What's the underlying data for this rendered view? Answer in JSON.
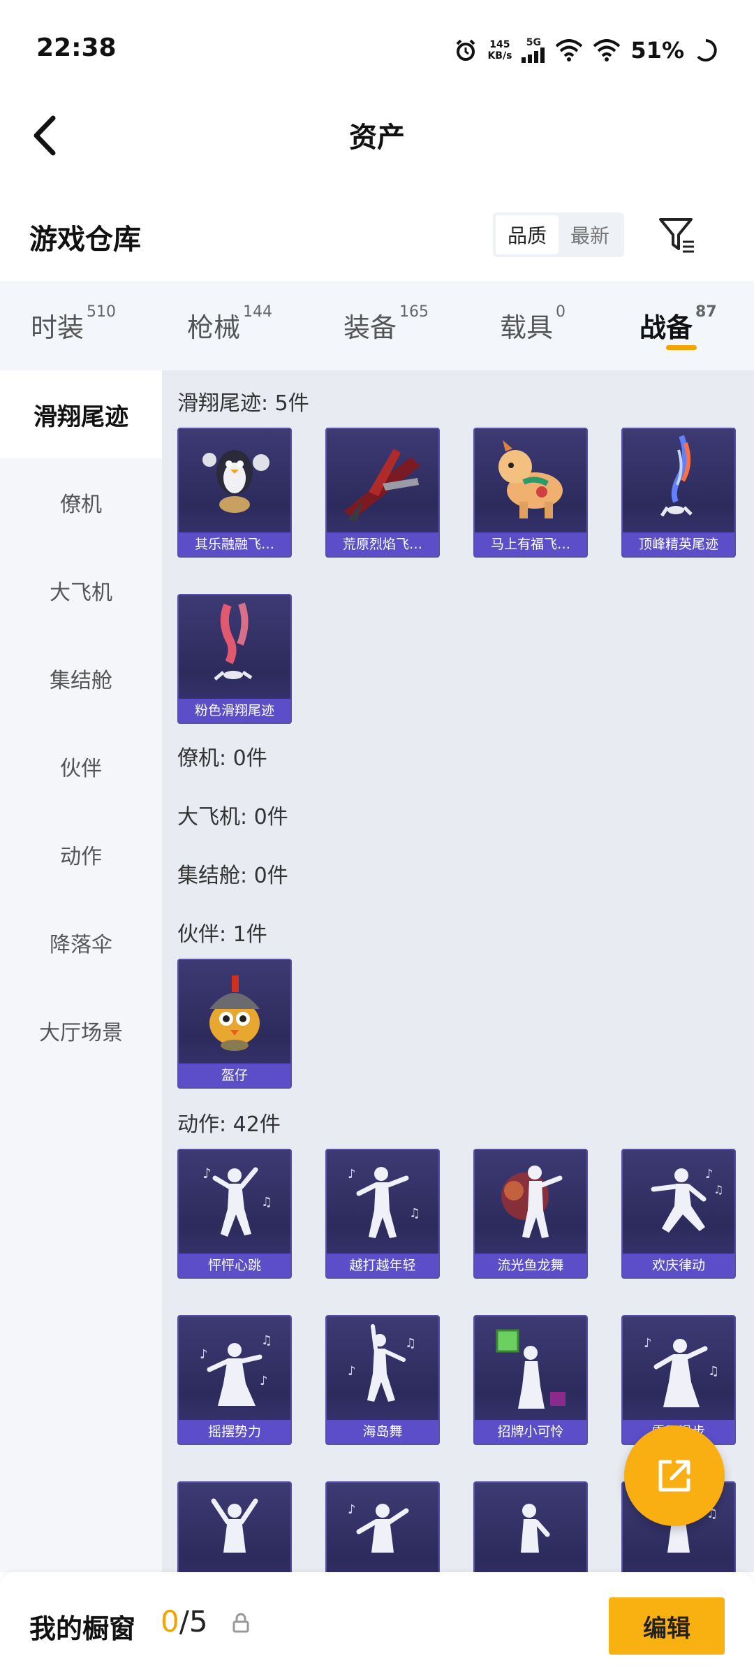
{
  "status": {
    "time": "22:38",
    "net_speed_value": "145",
    "net_speed_unit": "KB/s",
    "network": "5G",
    "battery": "51%"
  },
  "header": {
    "title": "资产",
    "back_icon": "chevron-left-icon"
  },
  "warehouse": {
    "title": "游戏仓库",
    "sort_options": [
      "品质",
      "最新"
    ],
    "sort_selected": "品质"
  },
  "tabs": [
    {
      "label": "时装",
      "count": "510"
    },
    {
      "label": "枪械",
      "count": "144"
    },
    {
      "label": "装备",
      "count": "165"
    },
    {
      "label": "载具",
      "count": "0"
    },
    {
      "label": "战备",
      "count": "87"
    }
  ],
  "active_tab": "战备",
  "sidebar": {
    "items": [
      {
        "label": "滑翔尾迹"
      },
      {
        "label": "僚机"
      },
      {
        "label": "大飞机"
      },
      {
        "label": "集结舱"
      },
      {
        "label": "伙伴"
      },
      {
        "label": "动作"
      },
      {
        "label": "降落伞"
      },
      {
        "label": "大厅场景"
      }
    ],
    "active": "滑翔尾迹"
  },
  "sections": {
    "trail": {
      "heading": "滑翔尾迹: 5件",
      "items": [
        "其乐融融飞…",
        "荒原烈焰飞…",
        "马上有福飞…",
        "顶峰精英尾迹",
        "粉色滑翔尾迹"
      ]
    },
    "wingman": {
      "heading": "僚机: 0件"
    },
    "plane": {
      "heading": "大飞机: 0件"
    },
    "pod": {
      "heading": "集结舱: 0件"
    },
    "companion": {
      "heading": "伙伴: 1件",
      "items": [
        "盔仔"
      ]
    },
    "emote": {
      "heading": "动作: 42件",
      "items": [
        "怦怦心跳",
        "越打越年轻",
        "流光鱼龙舞",
        "欢庆律动",
        "摇摆势力",
        "海岛舞",
        "招牌小可怜",
        "雷霆滑步"
      ]
    }
  },
  "showcase": {
    "label": "我的橱窗",
    "current": "0",
    "total": "/5",
    "edit_label": "编辑"
  },
  "colors": {
    "accent": "#f9b111",
    "card_bg": "#2f2d60",
    "card_label": "#5b4ec8"
  }
}
